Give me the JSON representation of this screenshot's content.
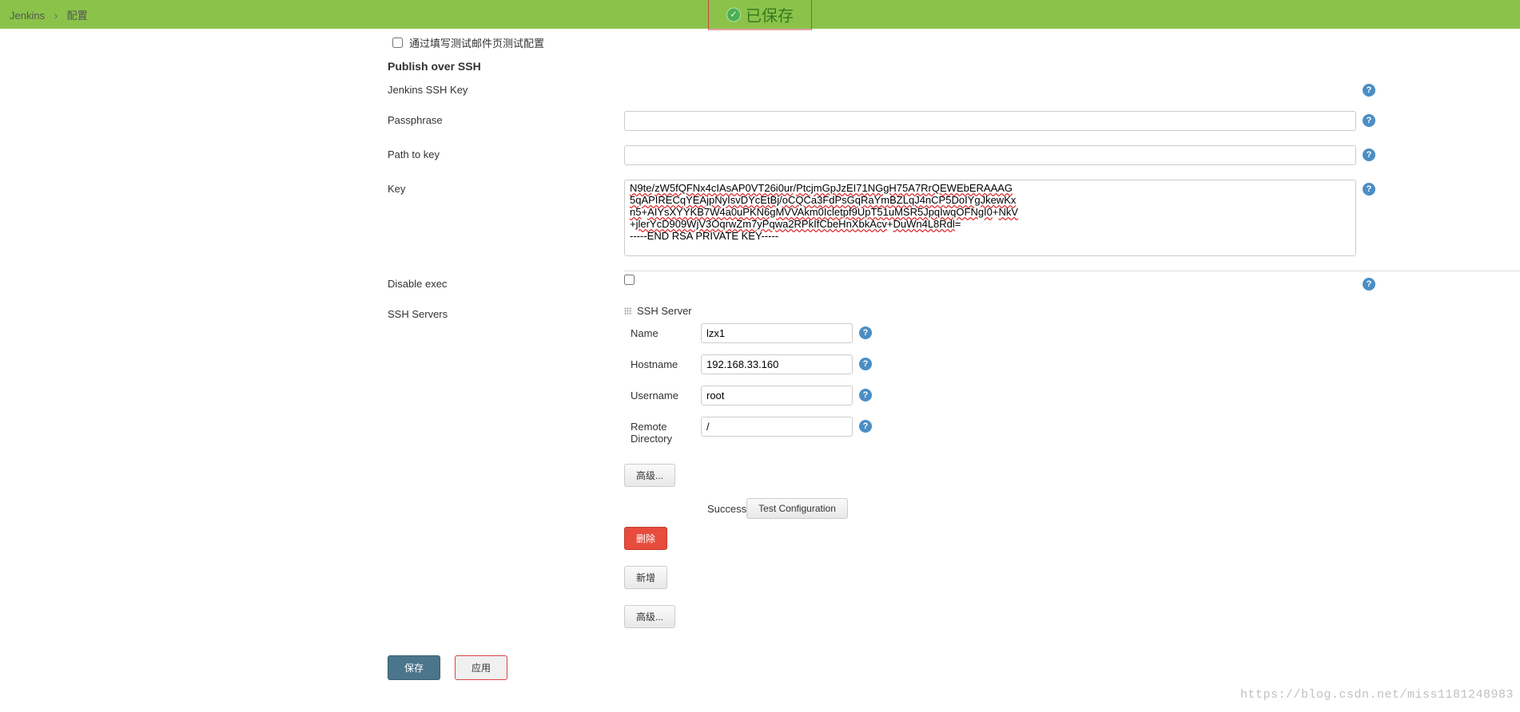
{
  "breadcrumb": {
    "home": "Jenkins",
    "separator": "›",
    "current": "配置"
  },
  "banner": {
    "saved": "已保存"
  },
  "checkbox_plugin": "通过填写测试邮件页测试配置",
  "section": {
    "publish_ssh": "Publish over SSH"
  },
  "labels": {
    "jenkins_ssh_key": "Jenkins SSH Key",
    "passphrase": "Passphrase",
    "path_to_key": "Path to key",
    "key": "Key",
    "disable_exec": "Disable exec",
    "ssh_servers": "SSH Servers"
  },
  "key_lines": {
    "l1a": "N9te",
    "l1b": "zW5fQFNx4cIAsAP0VT26i0ur",
    "l1c": "PtcjmGpJzEI71NGgH75A7RrQEWEbERAAAG",
    "l2a": "5qAPIRECqYEAjpNyIsvDYcEtBj",
    "l2b": "oCQCa3FdPsGqRaYmBZLqJ4nCP5DoIYgJkewKx",
    "l3a": "n5",
    "l3b": "AIYsXYYKB7W4a0uPKN6gMVVAkm0Icletpf9UpT51uMSR5JpqIwqOFNgI0",
    "l3c": "NkV",
    "l4a": "jlerYcD909WjV3OqrwZm7yPqwa2RPkIfCbeHnXbkAcv",
    "l4b": "DuWn4L8Rdl",
    "l5": "-----END RSA PRIVATE KEY-----"
  },
  "ssh_server": {
    "header": "SSH Server",
    "name_label": "Name",
    "name_value": "lzx1",
    "hostname_label": "Hostname",
    "hostname_value": "192.168.33.160",
    "username_label": "Username",
    "username_value": "root",
    "remote_dir_label": "Remote Directory",
    "remote_dir_value": "/"
  },
  "buttons": {
    "advanced": "高级...",
    "test_config": "Test Configuration",
    "delete": "删除",
    "add": "新增",
    "save": "保存",
    "apply": "应用"
  },
  "status": {
    "success": "Success"
  },
  "watermark": "https://blog.csdn.net/miss1181248983"
}
